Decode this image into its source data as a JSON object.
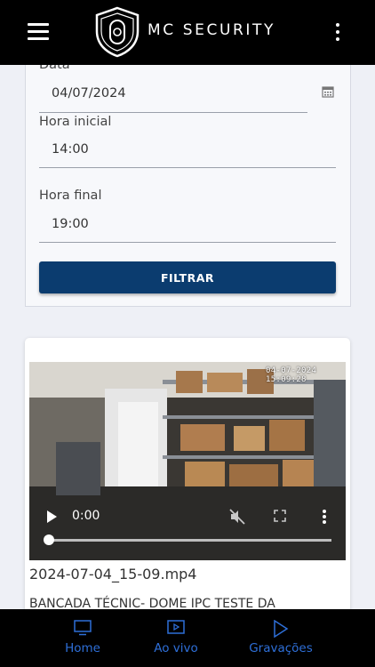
{
  "header": {
    "brand": "MC SECURITY"
  },
  "filter": {
    "date_label": "Data",
    "date_value": "04/07/2024",
    "start_label": "Hora inicial",
    "start_value": "14:00",
    "end_label": "Hora final",
    "end_value": "19:00",
    "button_label": "FILTRAR"
  },
  "recording": {
    "overlay_timestamp": "04-07-2024 15:09:28",
    "current_time": "0:00",
    "progress": 0,
    "filename": "2024-07-04_15-09.mp4",
    "description": "BANCADA TÉCNIC- DOME IPC TESTE DA"
  },
  "bottom_nav": {
    "items": [
      {
        "label": "Home",
        "icon": "monitor-icon"
      },
      {
        "label": "Ao vivo",
        "icon": "live-icon"
      },
      {
        "label": "Gravações",
        "icon": "play-icon"
      }
    ],
    "accent": "#2e6fd8"
  },
  "colors": {
    "topbar": "#000000",
    "button": "#0b3c6f",
    "background": "#eef0f6"
  }
}
